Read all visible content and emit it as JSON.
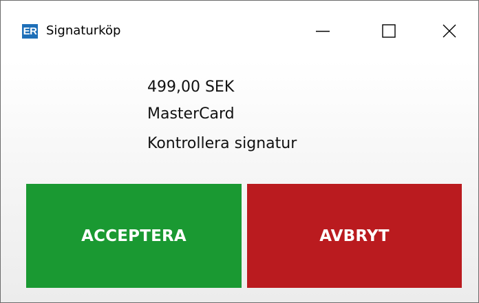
{
  "window": {
    "title": "Signaturköp",
    "app_icon_text": "ER",
    "app_icon_color": "#1e6fb8",
    "controls": {
      "minimize_icon": "minimize-icon",
      "maximize_icon": "maximize-icon",
      "close_icon": "close-icon"
    }
  },
  "transaction": {
    "amount": "499,00 SEK",
    "card_type": "MasterCard",
    "instruction": "Kontrollera signatur"
  },
  "actions": {
    "accept_label": "ACCEPTERA",
    "accept_color": "#1a9932",
    "cancel_label": "AVBRYT",
    "cancel_color": "#ba1b1f"
  }
}
